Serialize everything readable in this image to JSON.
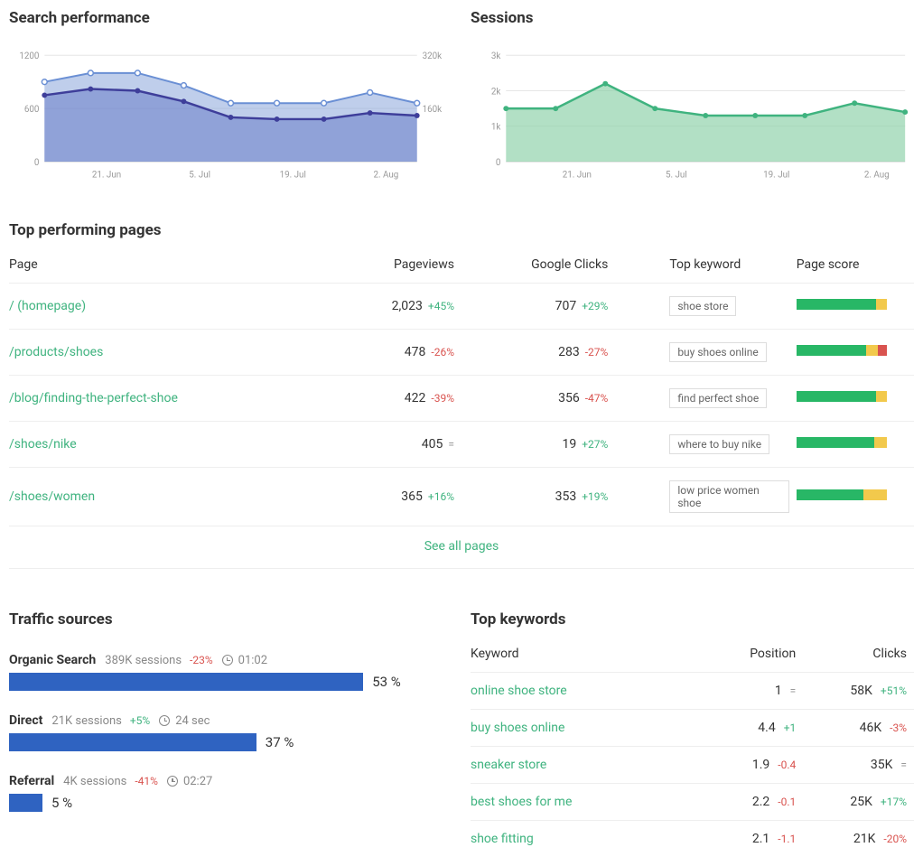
{
  "charts": {
    "search_performance": {
      "title": "Search performance",
      "x_ticks": [
        "21. Jun",
        "5. Jul",
        "19. Jul",
        "2. Aug"
      ],
      "y_left": [
        "0",
        "600",
        "1200"
      ],
      "y_right": [
        "160k",
        "320k"
      ]
    },
    "sessions": {
      "title": "Sessions",
      "x_ticks": [
        "21. Jun",
        "5. Jul",
        "19. Jul",
        "2. Aug"
      ],
      "y_left": [
        "0",
        "1k",
        "2k",
        "3k"
      ]
    }
  },
  "top_pages": {
    "title": "Top performing pages",
    "headers": {
      "page": "Page",
      "pageviews": "Pageviews",
      "clicks": "Google Clicks",
      "keyword": "Top keyword",
      "score": "Page score"
    },
    "see_all": "See all pages",
    "rows": [
      {
        "page": "/ (homepage)",
        "pageviews": "2,023",
        "pv_delta": "+45%",
        "pv_dir": "up",
        "clicks": "707",
        "cl_delta": "+29%",
        "cl_dir": "up",
        "keyword": "shoe store",
        "score": {
          "g": 88,
          "y": 12,
          "r": 0
        }
      },
      {
        "page": "/products/shoes",
        "pageviews": "478",
        "pv_delta": "-26%",
        "pv_dir": "down",
        "clicks": "283",
        "cl_delta": "-27%",
        "cl_dir": "down",
        "keyword": "buy shoes online",
        "score": {
          "g": 77,
          "y": 13,
          "r": 10
        }
      },
      {
        "page": "/blog/finding-the-perfect-shoe",
        "pageviews": "422",
        "pv_delta": "-39%",
        "pv_dir": "down",
        "clicks": "356",
        "cl_delta": "-47%",
        "cl_dir": "down",
        "keyword": "find perfect shoe",
        "score": {
          "g": 88,
          "y": 12,
          "r": 0
        }
      },
      {
        "page": "/shoes/nike",
        "pageviews": "405",
        "pv_delta": "=",
        "pv_dir": "eq",
        "clicks": "19",
        "cl_delta": "+27%",
        "cl_dir": "up",
        "keyword": "where to buy nike",
        "score": {
          "g": 86,
          "y": 14,
          "r": 0
        }
      },
      {
        "page": "/shoes/women",
        "pageviews": "365",
        "pv_delta": "+16%",
        "pv_dir": "up",
        "clicks": "353",
        "cl_delta": "+19%",
        "cl_dir": "up",
        "keyword": "low price women shoe",
        "score": {
          "g": 74,
          "y": 26,
          "r": 0
        }
      }
    ]
  },
  "traffic": {
    "title": "Traffic sources",
    "rows": [
      {
        "label": "Organic Search",
        "sessions": "389K sessions",
        "delta": "-23%",
        "dir": "down",
        "time": "01:02",
        "pct": 53,
        "pct_label": "53 %"
      },
      {
        "label": "Direct",
        "sessions": "21K sessions",
        "delta": "+5%",
        "dir": "up",
        "time": "24 sec",
        "pct": 37,
        "pct_label": "37 %"
      },
      {
        "label": "Referral",
        "sessions": "4K sessions",
        "delta": "-41%",
        "dir": "down",
        "time": "02:27",
        "pct": 5,
        "pct_label": "5 %"
      }
    ]
  },
  "top_keywords": {
    "title": "Top keywords",
    "headers": {
      "keyword": "Keyword",
      "position": "Position",
      "clicks": "Clicks"
    },
    "rows": [
      {
        "kw": "online shoe store",
        "pos": "1",
        "pos_delta": "=",
        "pos_dir": "eq",
        "clicks": "58K",
        "cl_delta": "+51%",
        "cl_dir": "up"
      },
      {
        "kw": "buy shoes online",
        "pos": "4.4",
        "pos_delta": "+1",
        "pos_dir": "up",
        "clicks": "46K",
        "cl_delta": "-3%",
        "cl_dir": "down"
      },
      {
        "kw": "sneaker store",
        "pos": "1.9",
        "pos_delta": "-0.4",
        "pos_dir": "down",
        "clicks": "35K",
        "cl_delta": "=",
        "cl_dir": "eq"
      },
      {
        "kw": "best shoes for me",
        "pos": "2.2",
        "pos_delta": "-0.1",
        "pos_dir": "down",
        "clicks": "25K",
        "cl_delta": "+17%",
        "cl_dir": "up"
      },
      {
        "kw": "shoe fitting",
        "pos": "2.1",
        "pos_delta": "-1.1",
        "pos_dir": "down",
        "clicks": "21K",
        "cl_delta": "-20%",
        "cl_dir": "down"
      }
    ]
  },
  "chart_data": [
    {
      "type": "area",
      "title": "Search performance",
      "x": [
        "14 Jun",
        "21 Jun",
        "28 Jun",
        "5 Jul",
        "12 Jul",
        "19 Jul",
        "26 Jul",
        "2 Aug",
        "9 Aug"
      ],
      "series": [
        {
          "name": "clicks (left axis)",
          "values": [
            900,
            1000,
            1000,
            860,
            660,
            660,
            660,
            780,
            660
          ],
          "ylim": [
            0,
            1200
          ]
        },
        {
          "name": "impressions (right axis)",
          "values": [
            200000,
            220000,
            210000,
            180000,
            135000,
            130000,
            130000,
            150000,
            140000
          ],
          "ylim": [
            0,
            320000
          ]
        }
      ],
      "xlabel": "",
      "ylabel": ""
    },
    {
      "type": "area",
      "title": "Sessions",
      "x": [
        "14 Jun",
        "21 Jun",
        "28 Jun",
        "5 Jul",
        "12 Jul",
        "19 Jul",
        "26 Jul",
        "2 Aug",
        "9 Aug"
      ],
      "series": [
        {
          "name": "sessions",
          "values": [
            1500,
            1500,
            2200,
            1500,
            1300,
            1300,
            1300,
            1650,
            1400
          ],
          "ylim": [
            0,
            3000
          ]
        }
      ],
      "xlabel": "",
      "ylabel": ""
    }
  ]
}
